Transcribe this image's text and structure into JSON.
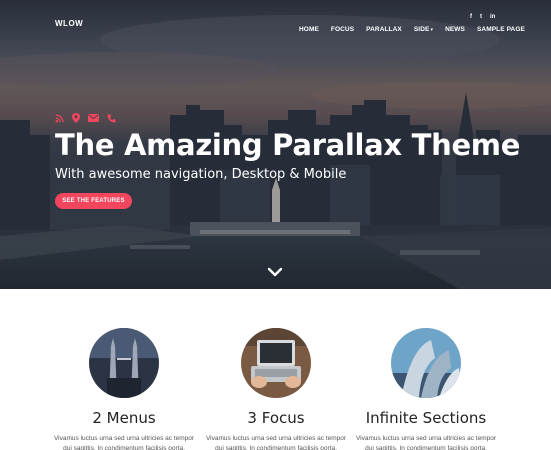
{
  "brand": {
    "logo": "WLOW"
  },
  "social_top": [
    {
      "icon": "facebook-icon",
      "glyph": "f"
    },
    {
      "icon": "twitter-icon",
      "glyph": "t"
    },
    {
      "icon": "linkedin-icon",
      "glyph": "in"
    }
  ],
  "nav": {
    "items": [
      "HOME",
      "FOCUS",
      "PARALLAX",
      "SIDE",
      "NEWS",
      "SAMPLE PAGE"
    ]
  },
  "hero": {
    "icons": [
      "rss-icon",
      "map-pin-icon",
      "mail-icon",
      "phone-icon"
    ],
    "title": "The Amazing Parallax Theme",
    "subtitle": "With awesome navigation, Desktop & Mobile",
    "cta_label": "SEE THE FEATURES",
    "accent_color": "#f2455e"
  },
  "features": [
    {
      "title": "2 Menus",
      "image": "twin-towers-photo",
      "text": "Vivamus luctus urna sed urna ultricies ac tempor dui sagittis. In condimentum facilisis porta."
    },
    {
      "title": "3 Focus",
      "image": "laptop-hands-photo",
      "text": "Vivamus luctus urna sed urna ultricies ac tempor dui sagittis. In condimentum facilisis porta."
    },
    {
      "title": "Infinite Sections",
      "image": "architecture-photo",
      "text": "Vivamus luctus urna sed urna ultricies ac tempor dui sagittis. In condimentum facilisis porta."
    }
  ]
}
